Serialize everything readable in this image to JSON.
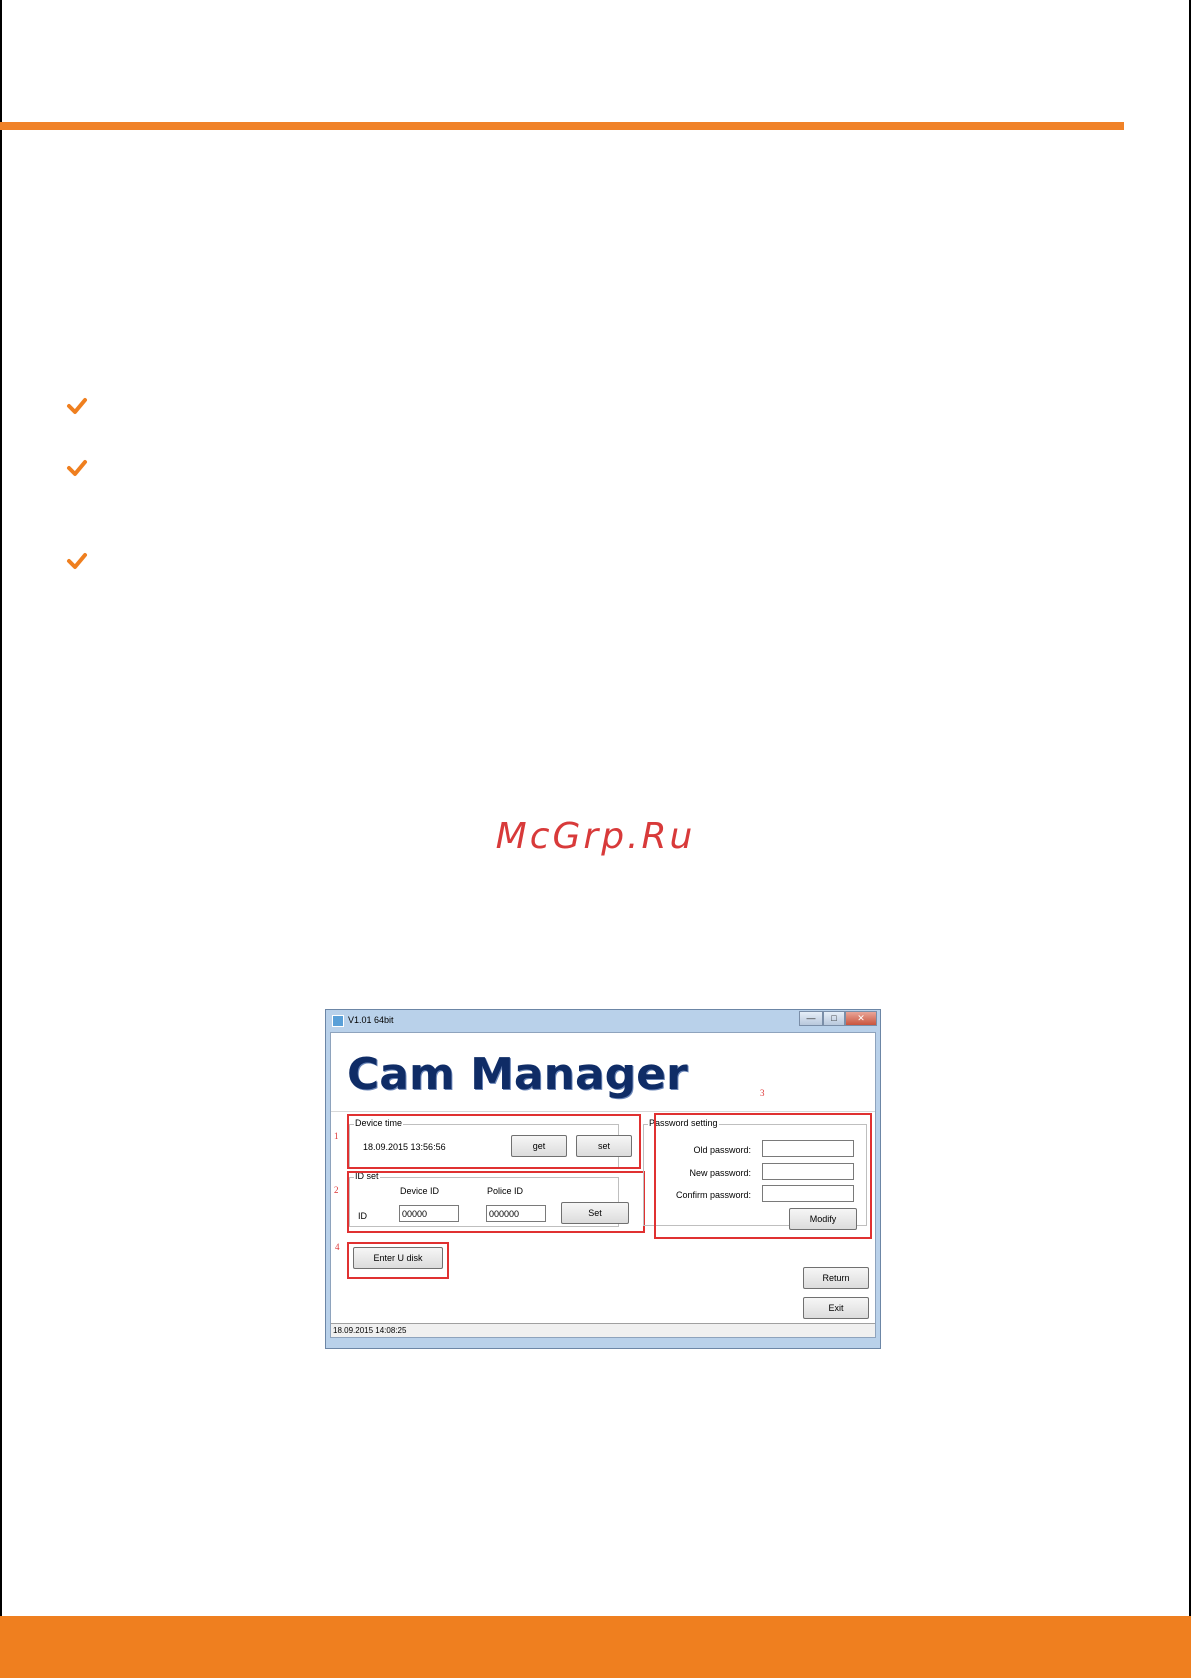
{
  "watermark": "McGrp.Ru",
  "window": {
    "title": "V1.01 64bit",
    "min_glyph": "—",
    "max_glyph": "□",
    "close_glyph": "✕",
    "banner": "Cam Manager",
    "annotations": [
      "1",
      "2",
      "3",
      "4"
    ],
    "device_time": {
      "group_label": "Device time",
      "value": "18.09.2015 13:56:56",
      "get_label": "get",
      "set_label": "set"
    },
    "id_set": {
      "group_label": "ID set",
      "device_id_label": "Device ID",
      "police_id_label": "Police ID",
      "row_label": "ID",
      "device_id_value": "00000",
      "police_id_value": "000000",
      "set_label": "Set"
    },
    "password": {
      "group_label": "Password setting",
      "old_label": "Old password:",
      "new_label": "New password:",
      "confirm_label": "Confirm password:",
      "modify_label": "Modify"
    },
    "enter_u_disk_label": "Enter U disk",
    "return_label": "Return",
    "exit_label": "Exit",
    "status": "18.09.2015 14:08:25"
  },
  "colors": {
    "accent": "#ef7f1f",
    "annotation_red": "#e03131",
    "banner_blue": "#0f2c66"
  },
  "icons": [
    "check-icon",
    "app-icon"
  ]
}
